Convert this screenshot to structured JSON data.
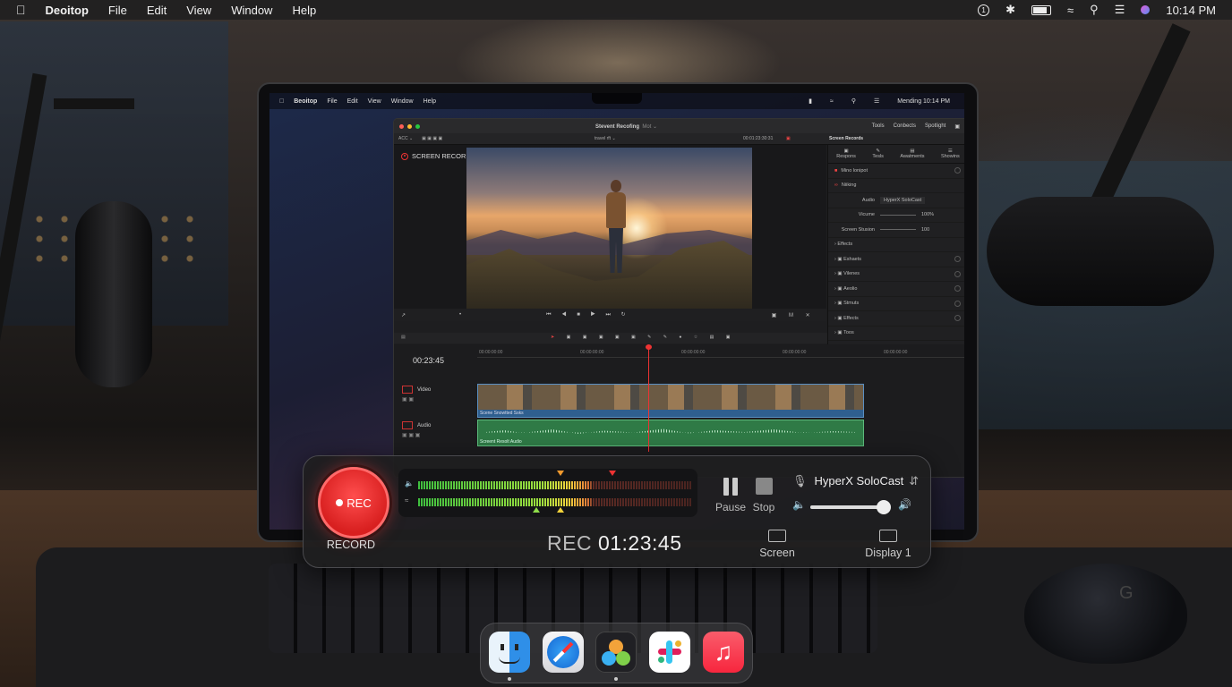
{
  "menubar": {
    "apple_icon": "apple-icon",
    "app_name": "Deoitop",
    "menus": [
      "File",
      "Edit",
      "View",
      "Window",
      "Help"
    ],
    "status_icons": [
      "1password-icon",
      "bluetooth-icon",
      "battery-icon",
      "wifi-icon",
      "search-icon",
      "control-center-icon",
      "siri-icon"
    ],
    "clock": "10:14 PM"
  },
  "laptop": {
    "inner_menubar": {
      "app_name": "Beoitop",
      "menus": [
        "File",
        "Edit",
        "View",
        "Window",
        "Help"
      ],
      "clock": "Mending 10:14 PM"
    },
    "editor": {
      "title": "Stevent Recofing",
      "title_suffix": "Mot ⌄",
      "header_tabs": [
        "Tools",
        "Conbects",
        "Spotlight"
      ],
      "toolbar_left": "ACC ⌄",
      "toolbar_center": "travel rft ⌄",
      "toolbar_timecode": "00:01:23:30:31",
      "viewer_overlay": "SCREEN RECORDING",
      "inspector_title": "Screen Records",
      "inspector_tabs": [
        "Respons",
        "Tesls",
        "Awatments",
        "Showins"
      ],
      "inspector_rows": [
        {
          "label": "Mino lonipot"
        },
        {
          "label": "Niiking"
        },
        {
          "label": "Audio",
          "value": "HyperX SoloCast"
        },
        {
          "label": "Vicume",
          "value": "100%"
        },
        {
          "label": "Screen Stusion",
          "value": "100"
        },
        {
          "label": "Effects"
        },
        {
          "label": "Eshaets"
        },
        {
          "label": "Vilenes"
        },
        {
          "label": "Aeolio"
        },
        {
          "label": "Stmuts"
        },
        {
          "label": "Effects"
        },
        {
          "label": "Toos"
        }
      ],
      "timeline": {
        "timecode": "00:23:45",
        "ruler": [
          "00:00:00:00",
          "00:00:00:00",
          "00:00:00:00",
          "00:00:00:00",
          "00:00:00:00"
        ],
        "video_track": "Video",
        "audio_track": "Audio",
        "video_clip_label": "Scene Snowtted Ssks",
        "audio_clip_label": "Screent Resolt Audio"
      }
    }
  },
  "recorder": {
    "rec_button": "REC",
    "rec_caption": "RECORD",
    "timer_prefix": "REC",
    "timer": "01:23:45",
    "pause_label": "Pause",
    "stop_label": "Stop",
    "input_device": "HyperX SoloCast",
    "input_volume_level": 0.95,
    "meter_level_left": 0.6,
    "meter_level_right": 0.65,
    "screen_label": "Screen",
    "display_label": "Display 1"
  },
  "dock": {
    "apps": [
      "finder-icon",
      "safari-icon",
      "davinci-resolve-icon",
      "slack-icon",
      "music-icon"
    ]
  },
  "colors": {
    "record_red": "#e0302f",
    "timeline_video": "#2f5f8f",
    "timeline_audio": "#2f7a46",
    "meter_green": "#3fbf3f",
    "meter_yellow": "#f2d23b"
  }
}
